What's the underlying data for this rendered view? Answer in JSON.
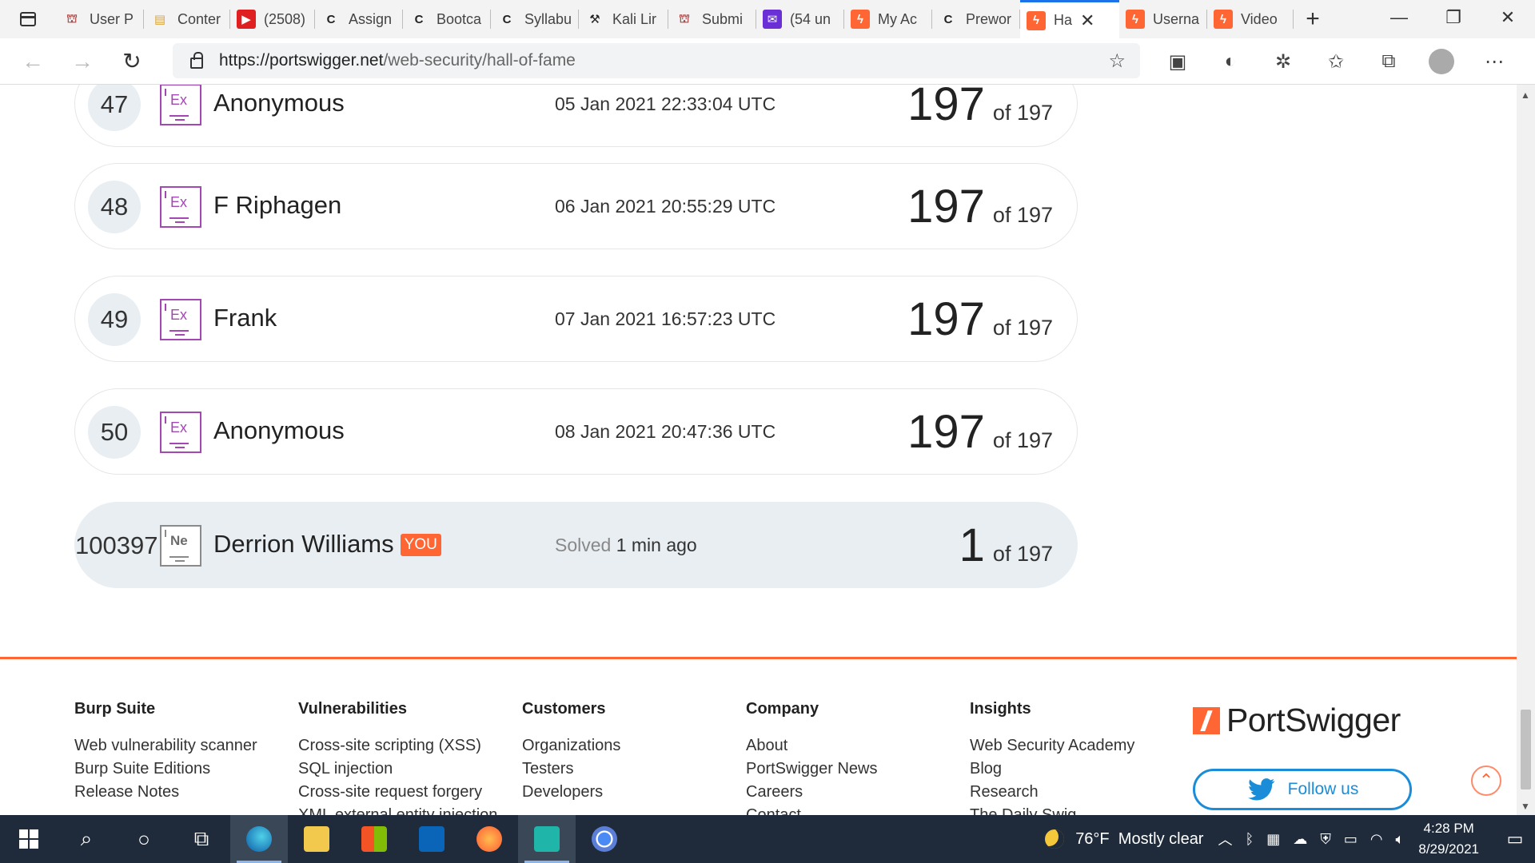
{
  "browser": {
    "tabs": [
      {
        "label": "User P",
        "icon": "university-icon",
        "color": "#b04a4a"
      },
      {
        "label": "Conter",
        "icon": "notes-icon",
        "color": "#d9a441"
      },
      {
        "label": "(2508)",
        "icon": "youtube-icon",
        "color": "#e02020"
      },
      {
        "label": "Assign",
        "icon": "c-icon",
        "color": "#222222"
      },
      {
        "label": "Bootca",
        "icon": "c-icon",
        "color": "#222222"
      },
      {
        "label": "Syllabu",
        "icon": "c-icon",
        "color": "#222222"
      },
      {
        "label": "Kali Lir",
        "icon": "kali-dragon-icon",
        "color": "#222222"
      },
      {
        "label": "Submi",
        "icon": "university-icon",
        "color": "#b04a4a"
      },
      {
        "label": "(54 un",
        "icon": "mail-icon",
        "color": "#6b2fd6"
      },
      {
        "label": "My Ac",
        "icon": "portswigger-icon",
        "color": "#ff6633"
      },
      {
        "label": "Prewor",
        "icon": "c-icon",
        "color": "#222222"
      },
      {
        "label": "Ha",
        "icon": "portswigger-icon",
        "color": "#ff6633",
        "active": true
      },
      {
        "label": "Userna",
        "icon": "portswigger-icon",
        "color": "#ff6633"
      },
      {
        "label": "Video",
        "icon": "portswigger-icon",
        "color": "#ff6633"
      }
    ],
    "url_host": "https://portswigger.net",
    "url_path": "/web-security/hall-of-fame"
  },
  "leaderboard": {
    "rows": [
      {
        "rank": "47",
        "badge": "Ex",
        "name": "Anonymous",
        "date": "05 Jan 2021 22:33:04 UTC",
        "solved": "197",
        "of": "of 197"
      },
      {
        "rank": "48",
        "badge": "Ex",
        "name": "F Riphagen",
        "date": "06 Jan 2021 20:55:29 UTC",
        "solved": "197",
        "of": "of 197"
      },
      {
        "rank": "49",
        "badge": "Ex",
        "name": "Frank",
        "date": "07 Jan 2021 16:57:23 UTC",
        "solved": "197",
        "of": "of 197"
      },
      {
        "rank": "50",
        "badge": "Ex",
        "name": "Anonymous",
        "date": "08 Jan 2021 20:47:36 UTC",
        "solved": "197",
        "of": "of 197"
      }
    ],
    "you": {
      "rank": "100397",
      "badge": "Ne",
      "name": "Derrion Williams",
      "tag": "YOU",
      "solved_label": "Solved",
      "solved_when": "1 min ago",
      "solved": "1",
      "of": "of 197"
    }
  },
  "footer": {
    "columns": [
      {
        "title": "Burp Suite",
        "links": [
          "Web vulnerability scanner",
          "Burp Suite Editions",
          "Release Notes"
        ]
      },
      {
        "title": "Vulnerabilities",
        "links": [
          "Cross-site scripting (XSS)",
          "SQL injection",
          "Cross-site request forgery",
          "XML external entity injection"
        ]
      },
      {
        "title": "Customers",
        "links": [
          "Organizations",
          "Testers",
          "Developers"
        ]
      },
      {
        "title": "Company",
        "links": [
          "About",
          "PortSwigger News",
          "Careers",
          "Contact"
        ]
      },
      {
        "title": "Insights",
        "links": [
          "Web Security Academy",
          "Blog",
          "Research",
          "The Daily Swig"
        ]
      }
    ],
    "brand": "PortSwigger",
    "follow_label": "Follow us",
    "accent": "#ff6633",
    "twitter_color": "#1a8cd8"
  },
  "taskbar": {
    "weather_temp": "76°F",
    "weather_desc": "Mostly clear",
    "time": "4:28 PM",
    "date": "8/29/2021"
  }
}
